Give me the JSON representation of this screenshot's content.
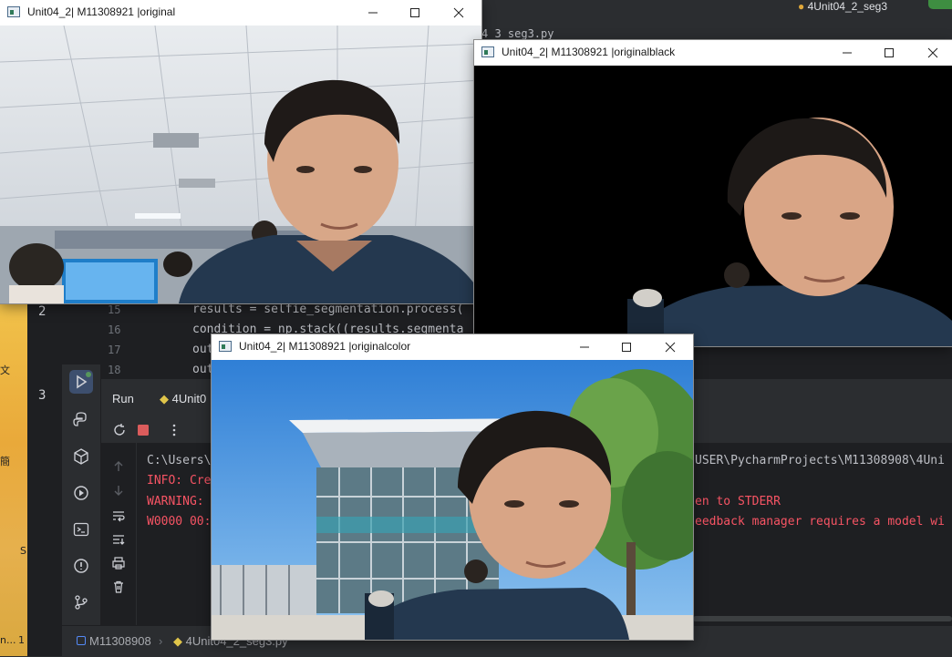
{
  "desktop": {
    "chars": [
      "文",
      "簡",
      "S",
      "n...",
      "1"
    ]
  },
  "ide": {
    "top_file": "4_3_seg3.py",
    "top_run_config": "4Unit04_2_seg3",
    "gutter_numbers": [
      "2",
      "3"
    ],
    "line_numbers": [
      "15",
      "16",
      "17",
      "18"
    ],
    "code_lines": [
      "results = selfie_segmentation.process(",
      "condition = np.stack((results.segmenta",
      "out",
      "out"
    ],
    "run": {
      "label": "Run",
      "tab": "4Unit0"
    },
    "console_lines": [
      {
        "left": "C:\\Users\\",
        "right": "USER\\PycharmProjects\\M11308908\\4Uni",
        "color": "#bcbec4"
      },
      {
        "left": "INFO: Cre",
        "right": "",
        "color": "#f75464"
      },
      {
        "left": "WARNING: ",
        "right": "en to STDERR",
        "color": "#f75464"
      },
      {
        "left": "W0000 00:",
        "right": "eedback manager requires a model wi",
        "color": "#f75464"
      }
    ],
    "breadcrumb": {
      "project": "M11308908",
      "file": "4Unit04_2_seg3.py"
    }
  },
  "windows": {
    "original": {
      "title": "Unit04_2| M11308921  |original"
    },
    "originalblack": {
      "title": "Unit04_2| M11308921 |originalblack"
    },
    "originalcolor": {
      "title": "Unit04_2| M11308921 |originalcolor"
    }
  },
  "colors": {
    "ide_bg": "#1e1f22",
    "panel": "#2b2d30",
    "error": "#f75464",
    "text": "#bcbec4"
  }
}
